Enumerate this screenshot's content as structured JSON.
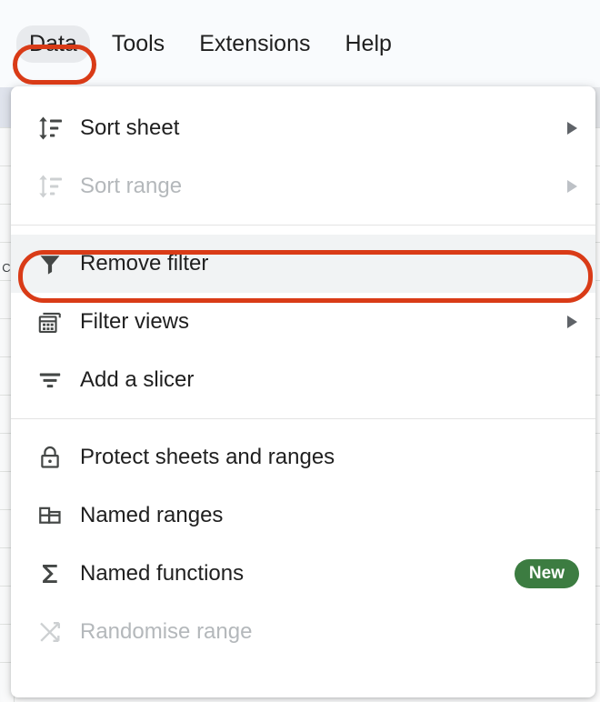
{
  "menubar": {
    "items": [
      {
        "label": "Data",
        "active": true
      },
      {
        "label": "Tools",
        "active": false
      },
      {
        "label": "Extensions",
        "active": false
      },
      {
        "label": "Help",
        "active": false
      }
    ]
  },
  "annotations": {
    "color": "#d93b17",
    "targets": [
      "Data",
      "Remove filter"
    ]
  },
  "sheet": {
    "row_header_label": "C"
  },
  "menu": {
    "groups": [
      {
        "items": [
          {
            "label": "Sort sheet",
            "icon": "sort-icon",
            "submenu": true,
            "disabled": false,
            "highlighted": false,
            "badge": ""
          },
          {
            "label": "Sort range",
            "icon": "sort-icon",
            "submenu": true,
            "disabled": true,
            "highlighted": false,
            "badge": ""
          }
        ]
      },
      {
        "items": [
          {
            "label": "Remove filter",
            "icon": "filter-icon",
            "submenu": false,
            "disabled": false,
            "highlighted": true,
            "badge": ""
          },
          {
            "label": "Filter views",
            "icon": "filter-views-icon",
            "submenu": true,
            "disabled": false,
            "highlighted": false,
            "badge": ""
          },
          {
            "label": "Add a slicer",
            "icon": "slicer-icon",
            "submenu": false,
            "disabled": false,
            "highlighted": false,
            "badge": ""
          }
        ]
      },
      {
        "items": [
          {
            "label": "Protect sheets and ranges",
            "icon": "lock-icon",
            "submenu": false,
            "disabled": false,
            "highlighted": false,
            "badge": ""
          },
          {
            "label": "Named ranges",
            "icon": "table-icon",
            "submenu": false,
            "disabled": false,
            "highlighted": false,
            "badge": ""
          },
          {
            "label": "Named functions",
            "icon": "sigma-icon",
            "submenu": false,
            "disabled": false,
            "highlighted": false,
            "badge": "New"
          },
          {
            "label": "Randomise range",
            "icon": "shuffle-icon",
            "submenu": false,
            "disabled": true,
            "highlighted": false,
            "badge": ""
          }
        ]
      }
    ]
  },
  "colors": {
    "accent_annotation": "#d93b17",
    "badge_green": "#3c7c41",
    "menu_highlight": "#f1f3f4",
    "chip_active": "#e8eaed",
    "text_primary": "#1f1f1f",
    "text_disabled": "#b4b8bb"
  }
}
